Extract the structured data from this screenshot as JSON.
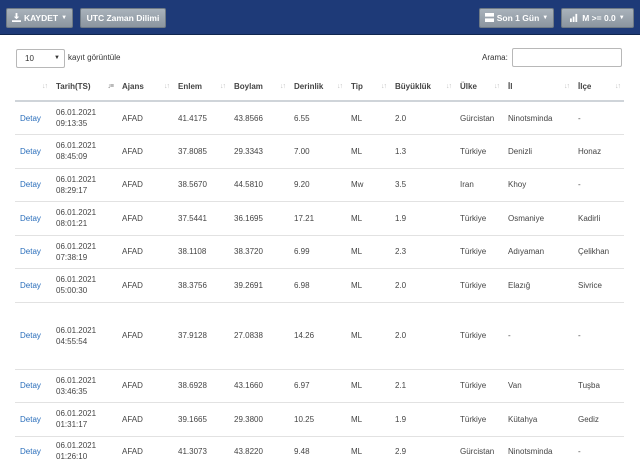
{
  "toolbar": {
    "export_label": "KAYDET",
    "utc_label": "UTC Zaman Dilimi",
    "time_filter_label": "Son 1 Gün",
    "magnitude_filter_label": "M >= 0.0"
  },
  "controls": {
    "page_length_value": "10",
    "page_length_label": "kayıt görüntüle",
    "search_label": "Arama:",
    "search_value": ""
  },
  "table": {
    "headers": [
      "",
      "Tarih(TS)",
      "Ajans",
      "Enlem",
      "Boylam",
      "Derinlik",
      "Tip",
      "Büyüklük",
      "Ülke",
      "İl",
      "İlçe"
    ],
    "rows": [
      {
        "link": "Detay",
        "date": "06.01.2021",
        "time": "09:13:35",
        "agency": "AFAD",
        "lat": "41.4175",
        "lon": "43.8566",
        "depth": "6.55",
        "type": "ML",
        "mag": "2.0",
        "country": "Gürcistan",
        "province": "Ninotsminda",
        "district": "-"
      },
      {
        "link": "Detay",
        "date": "06.01.2021",
        "time": "08:45:09",
        "agency": "AFAD",
        "lat": "37.8085",
        "lon": "29.3343",
        "depth": "7.00",
        "type": "ML",
        "mag": "1.3",
        "country": "Türkiye",
        "province": "Denizli",
        "district": "Honaz"
      },
      {
        "link": "Detay",
        "date": "06.01.2021",
        "time": "08:29:17",
        "agency": "AFAD",
        "lat": "38.5670",
        "lon": "44.5810",
        "depth": "9.20",
        "type": "Mw",
        "mag": "3.5",
        "country": "Iran",
        "province": "Khoy",
        "district": "-"
      },
      {
        "link": "Detay",
        "date": "06.01.2021",
        "time": "08:01:21",
        "agency": "AFAD",
        "lat": "37.5441",
        "lon": "36.1695",
        "depth": "17.21",
        "type": "ML",
        "mag": "1.9",
        "country": "Türkiye",
        "province": "Osmaniye",
        "district": "Kadirli"
      },
      {
        "link": "Detay",
        "date": "06.01.2021",
        "time": "07:38:19",
        "agency": "AFAD",
        "lat": "38.1108",
        "lon": "38.3720",
        "depth": "6.99",
        "type": "ML",
        "mag": "2.3",
        "country": "Türkiye",
        "province": "Adıyaman",
        "district": "Çelikhan"
      },
      {
        "link": "Detay",
        "date": "06.01.2021",
        "time": "05:00:30",
        "agency": "AFAD",
        "lat": "38.3756",
        "lon": "39.2691",
        "depth": "6.98",
        "type": "ML",
        "mag": "2.0",
        "country": "Türkiye",
        "province": "Elazığ",
        "district": "Sivrice"
      },
      {
        "link": "Detay",
        "date": "06.01.2021",
        "time": "04:55:54",
        "agency": "AFAD",
        "lat": "37.9128",
        "lon": "27.0838",
        "depth": "14.26",
        "type": "ML",
        "mag": "2.0",
        "country": "Türkiye",
        "province": "-",
        "district": "-"
      },
      {
        "link": "Detay",
        "date": "06.01.2021",
        "time": "03:46:35",
        "agency": "AFAD",
        "lat": "38.6928",
        "lon": "43.1660",
        "depth": "6.97",
        "type": "ML",
        "mag": "2.1",
        "country": "Türkiye",
        "province": "Van",
        "district": "Tuşba"
      },
      {
        "link": "Detay",
        "date": "06.01.2021",
        "time": "01:31:17",
        "agency": "AFAD",
        "lat": "39.1665",
        "lon": "29.3800",
        "depth": "10.25",
        "type": "ML",
        "mag": "1.9",
        "country": "Türkiye",
        "province": "Kütahya",
        "district": "Gediz"
      },
      {
        "link": "Detay",
        "date": "06.01.2021",
        "time": "01:26:10",
        "agency": "AFAD",
        "lat": "41.3073",
        "lon": "43.8220",
        "depth": "9.48",
        "type": "ML",
        "mag": "2.9",
        "country": "Gürcistan",
        "province": "Ninotsminda",
        "district": "-"
      }
    ]
  }
}
